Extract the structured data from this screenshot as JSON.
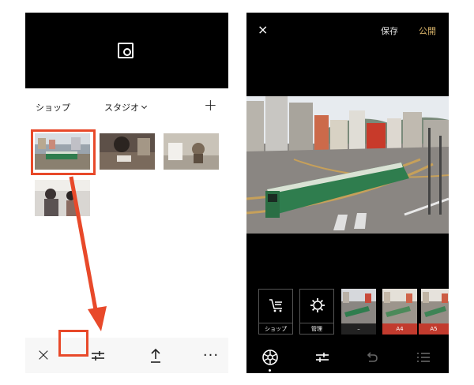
{
  "left_screen": {
    "nav": {
      "shop_label": "ショップ",
      "studio_label": "スタジオ",
      "add_label": "+"
    },
    "toolbar": {
      "close_label": "×",
      "more_label": "···"
    },
    "icons": [
      "viewfinder-icon",
      "close-icon",
      "adjust-icon",
      "share-icon",
      "more-icon"
    ]
  },
  "right_screen": {
    "header": {
      "close_label": "×",
      "save_label": "保存",
      "publish_label": "公開"
    },
    "tools": [
      {
        "label": "ショップ",
        "icon": "cart-icon"
      },
      {
        "label": "管理",
        "icon": "gear-icon"
      }
    ],
    "presets": [
      {
        "label": "–"
      },
      {
        "label": "A4"
      },
      {
        "label": "A5"
      }
    ],
    "bottom_icons": [
      "filters-icon",
      "adjust-icon",
      "undo-icon",
      "list-icon"
    ]
  },
  "colors": {
    "highlight": "#e8492a",
    "publish": "#d8b36a",
    "preset_selected": "#c23b2e",
    "dark_bg": "#000000"
  }
}
